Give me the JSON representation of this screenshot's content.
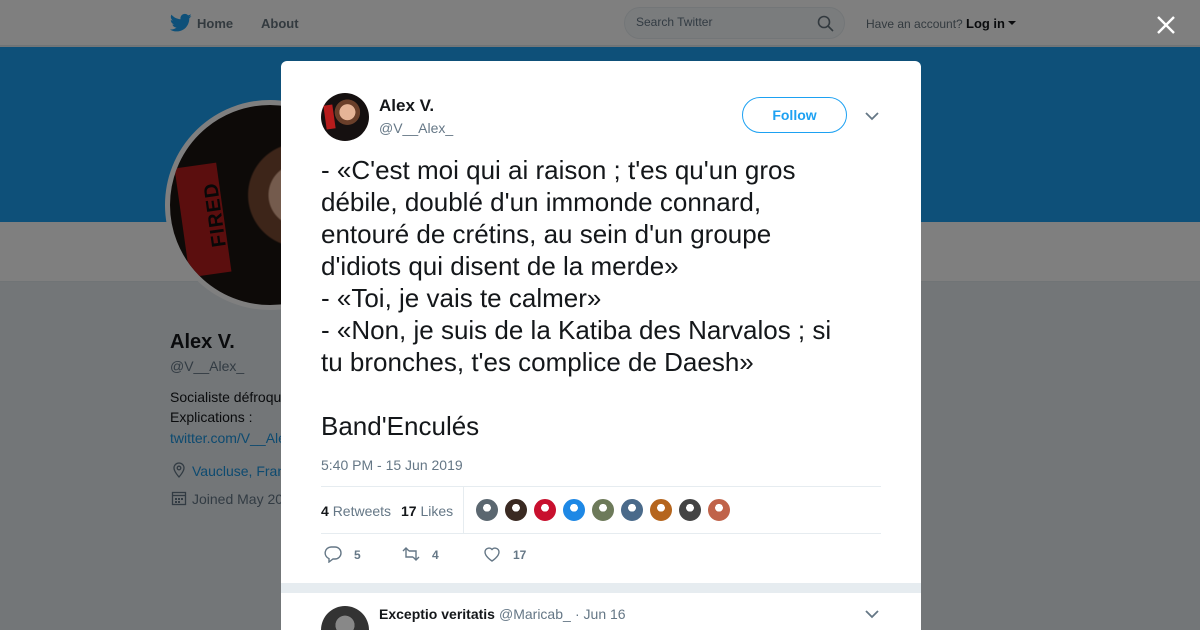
{
  "nav": {
    "home_label": "Home",
    "about_label": "About",
    "search_placeholder": "Search Twitter",
    "account_prompt": "Have an account?",
    "login_label": "Log in"
  },
  "profile": {
    "name": "Alex V.",
    "handle": "@V__Alex_",
    "bio_line1": "Socialiste défroqu",
    "bio_line2": "Explications :",
    "link": "twitter.com/V__Ale",
    "location": "Vaucluse, Fran",
    "joined": "Joined May 20",
    "avatar_stamp": "FIRED"
  },
  "tweet": {
    "author_name": "Alex V.",
    "author_handle": "@V__Alex_",
    "follow_label": "Follow",
    "lines": [
      "- «C'est moi qui ai raison ; t'es qu'un gros",
      "débile, doublé d'un immonde connard,",
      "entouré de crétins, au sein d'un groupe",
      "d'idiots qui disent de la merde»",
      "- «Toi, je vais te calmer»",
      "- «Non, je suis de la Katiba des Narvalos ; si",
      "tu bronches, t'es complice de Daesh»"
    ],
    "signature": "Band'Enculés",
    "timestamp": "5:40 PM - 15 Jun 2019",
    "retweet_count": "4",
    "retweet_label": "Retweets",
    "like_count": "17",
    "like_label": "Likes",
    "reply_action_count": "5",
    "retweet_action_count": "4",
    "like_action_count": "17",
    "liker_colors": [
      "#5b6770",
      "#3a2a22",
      "#c8102e",
      "#1e88e5",
      "#6d7a5a",
      "#4a6a8a",
      "#b5651d",
      "#444444",
      "#c0634a"
    ]
  },
  "reply": {
    "name": "Exceptio veritatis",
    "handle": "@Maricab_",
    "date": "· Jun 16"
  },
  "colors": {
    "brand": "#1da1f2",
    "text": "#14171a",
    "muted": "#657786"
  }
}
